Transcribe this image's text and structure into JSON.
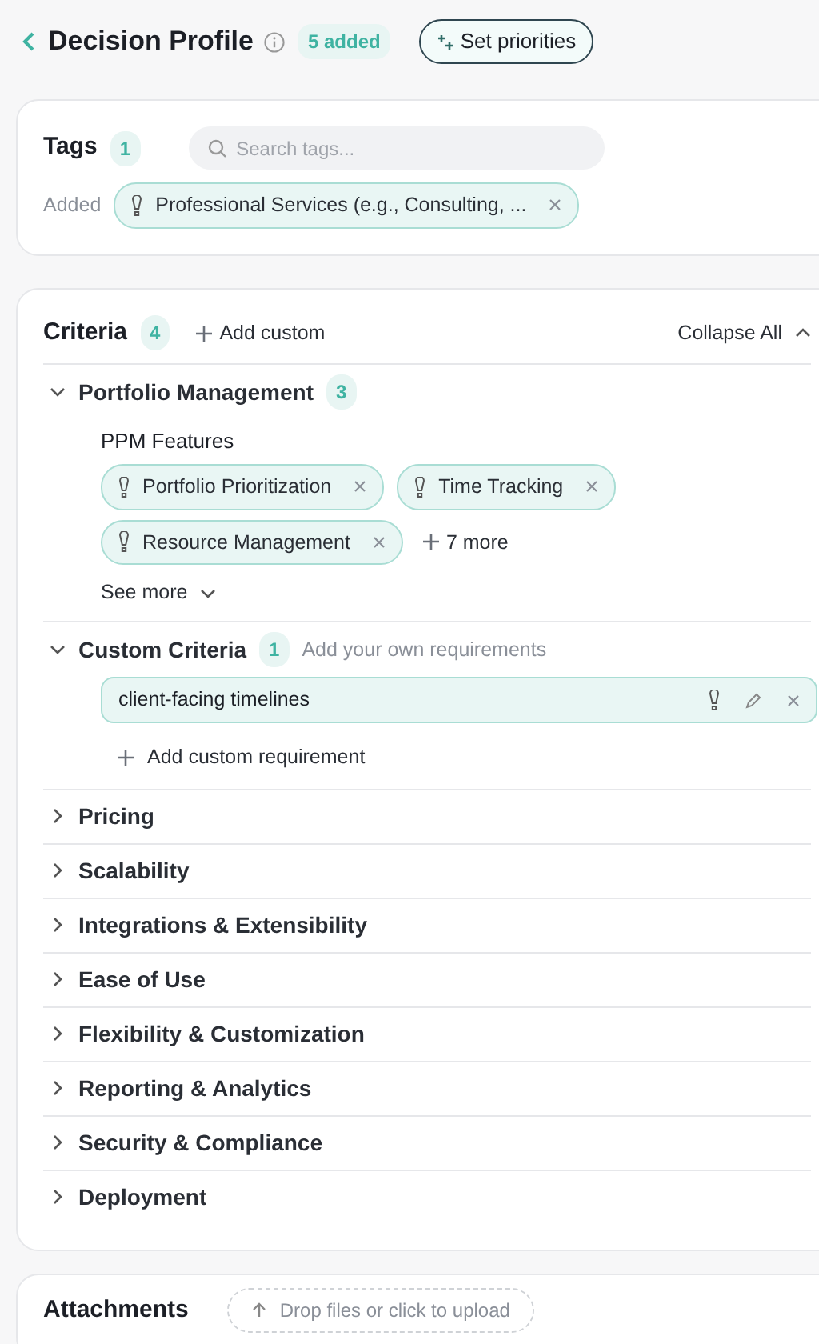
{
  "header": {
    "title": "Decision Profile",
    "badge": "5 added",
    "priorities_button": "Set priorities"
  },
  "tags": {
    "title": "Tags",
    "count": "1",
    "search": {
      "placeholder": "Search tags..."
    },
    "added_label": "Added",
    "chips": [
      {
        "label": "Professional Services (e.g., Consulting, ..."
      }
    ]
  },
  "criteria": {
    "title": "Criteria",
    "count": "4",
    "add_custom": "Add custom",
    "collapse_all": "Collapse All",
    "sections": [
      {
        "kind": "features",
        "title": "Portfolio Management",
        "count": "3",
        "expanded": true,
        "groups": [
          {
            "title": "PPM Features",
            "chips": [
              {
                "label": "Portfolio Prioritization"
              },
              {
                "label": "Time Tracking"
              },
              {
                "label": "Resource Management"
              }
            ],
            "more": "7 more"
          }
        ],
        "see_more": "See more"
      },
      {
        "kind": "custom",
        "title": "Custom Criteria",
        "count": "1",
        "hint": "Add your own requirements",
        "expanded": true,
        "items": [
          {
            "label": "client-facing timelines"
          }
        ],
        "add": "Add custom requirement"
      },
      {
        "kind": "plain",
        "title": "Pricing",
        "expanded": false
      },
      {
        "kind": "plain",
        "title": "Scalability",
        "expanded": false
      },
      {
        "kind": "plain",
        "title": "Integrations & Extensibility",
        "expanded": false
      },
      {
        "kind": "plain",
        "title": "Ease of Use",
        "expanded": false
      },
      {
        "kind": "plain",
        "title": "Flexibility & Customization",
        "expanded": false
      },
      {
        "kind": "plain",
        "title": "Reporting & Analytics",
        "expanded": false
      },
      {
        "kind": "plain",
        "title": "Security & Compliance",
        "expanded": false
      },
      {
        "kind": "plain",
        "title": "Deployment",
        "expanded": false
      }
    ]
  },
  "attachments": {
    "title": "Attachments",
    "dropzone": "Drop files or click to upload"
  }
}
